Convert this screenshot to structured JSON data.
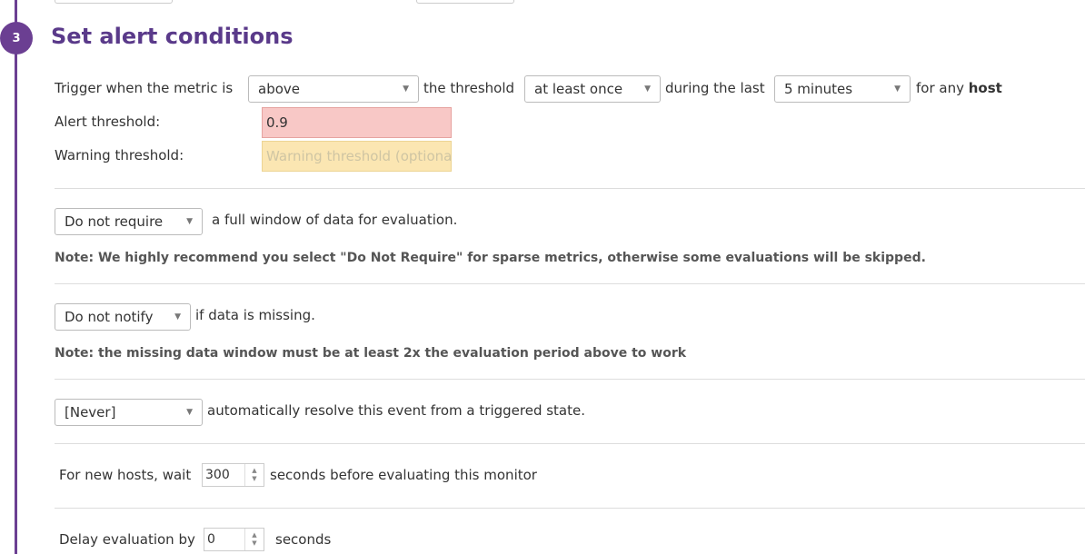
{
  "step": {
    "number": "3",
    "title": "Set alert conditions"
  },
  "trigger": {
    "prefix": "Trigger when the metric is",
    "comparator": "above",
    "threshold_text": "the threshold",
    "frequency": "at least once",
    "during_text": "during the last",
    "window": "5 minutes",
    "for_any": "for any",
    "group": "host"
  },
  "thresholds": {
    "alert_label": "Alert threshold:",
    "alert_value": "0.9",
    "warning_label": "Warning threshold:",
    "warning_placeholder": "Warning threshold (optiona"
  },
  "full_window": {
    "select": "Do not require",
    "text": "a full window of data for evaluation.",
    "note": "Note: We highly recommend you select \"Do Not Require\" for sparse metrics, otherwise some evaluations will be skipped."
  },
  "missing_data": {
    "select": "Do not notify",
    "text": "if data is missing.",
    "note": "Note: the missing data window must be at least 2x the evaluation period above to work"
  },
  "auto_resolve": {
    "select": "[Never]",
    "text": "automatically resolve this event from a triggered state."
  },
  "new_hosts": {
    "prefix": "For new hosts, wait",
    "value": "300",
    "suffix": "seconds before evaluating this monitor"
  },
  "delay": {
    "prefix": "Delay evaluation by",
    "value": "0",
    "suffix": "seconds"
  },
  "icons": {
    "caret": "caret-down-icon",
    "spinner": "spinner-arrows-icon"
  },
  "colors": {
    "accent": "#6b3f92",
    "alert_bg": "#f8c8c6",
    "warning_bg": "#fbe6b2"
  }
}
